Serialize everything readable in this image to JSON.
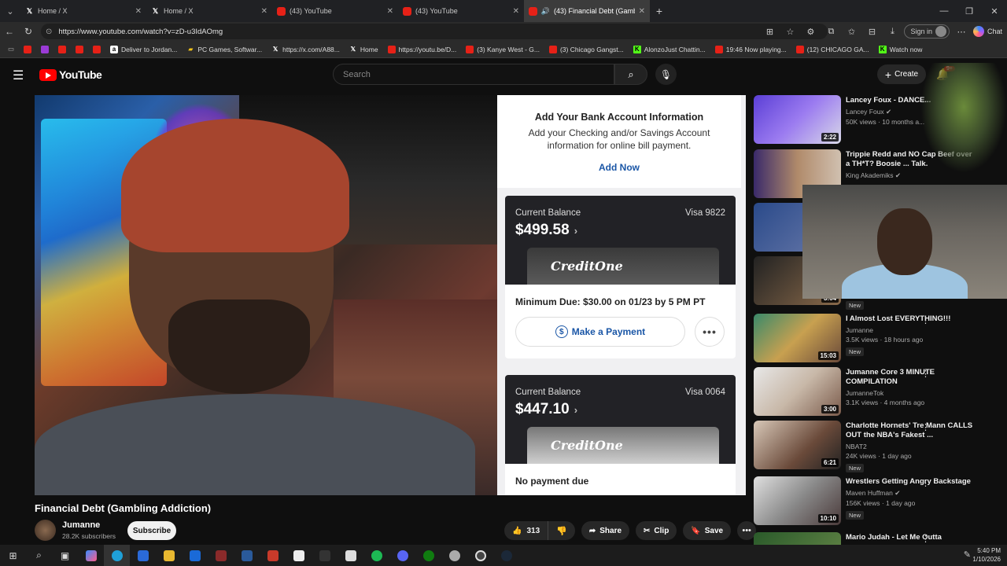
{
  "browser": {
    "tabs": [
      {
        "title": "Home / X",
        "icon": "x-icon"
      },
      {
        "title": "Home / X",
        "icon": "x-icon"
      },
      {
        "title": "(43) YouTube",
        "icon": "youtube-icon"
      },
      {
        "title": "(43) YouTube",
        "icon": "youtube-icon"
      },
      {
        "title": "(43) Financial Debt (Gambling",
        "icon": "youtube-icon",
        "active": true
      }
    ],
    "url": "https://www.youtube.com/watch?v=zD-u3IdAOmg",
    "signin_label": "Sign in",
    "chat_label": "Chat",
    "bookmarks": [
      {
        "label": "",
        "icon": "youtube-icon"
      },
      {
        "label": "",
        "icon": "purple-icon"
      },
      {
        "label": "",
        "icon": "youtube-icon"
      },
      {
        "label": "",
        "icon": "youtube-icon"
      },
      {
        "label": "",
        "icon": "youtube-icon"
      },
      {
        "label": "Deliver to Jordan...",
        "icon": "amazon-icon"
      },
      {
        "label": "PC Games, Softwar...",
        "icon": "pc-icon"
      },
      {
        "label": "https://x.com/A88...",
        "icon": "x-icon"
      },
      {
        "label": "Home",
        "icon": "x-icon"
      },
      {
        "label": "https://youtu.be/D...",
        "icon": "youtube-icon"
      },
      {
        "label": "(3) Kanye West - G...",
        "icon": "youtube-icon"
      },
      {
        "label": "(3) Chicago Gangst...",
        "icon": "youtube-icon"
      },
      {
        "label": "AlonzoJust Chattin...",
        "icon": "kick-icon"
      },
      {
        "label": "19:46 Now playing...",
        "icon": "youtube-icon"
      },
      {
        "label": "(12) CHICAGO GA...",
        "icon": "youtube-icon"
      },
      {
        "label": "Watch now",
        "icon": "kick-icon"
      }
    ]
  },
  "youtube": {
    "logo_text": "YouTube",
    "search_placeholder": "Search",
    "create_label": "Create",
    "notif_count": "9+"
  },
  "video_overlay": {
    "bank_title": "Add Your Bank Account Information",
    "bank_desc": "Add your Checking and/or Savings Account information for online bill payment.",
    "add_now": "Add Now",
    "cards": [
      {
        "label": "Current Balance",
        "visa": "Visa 9822",
        "balance": "$499.58",
        "brand": "CreditOne",
        "min_due": "Minimum Due: $30.00 on 01/23 by 5 PM PT",
        "pay_label": "Make a Payment"
      },
      {
        "label": "Current Balance",
        "visa": "Visa 0064",
        "balance": "$447.10",
        "brand": "CreditOne",
        "min_due": "No payment due"
      }
    ]
  },
  "video": {
    "title": "Financial Debt (Gambling Addiction)",
    "channel": "Jumanne",
    "subscribers": "28.2K subscribers",
    "subscribe_label": "Subscribe",
    "likes": "313",
    "share_label": "Share",
    "clip_label": "Clip",
    "save_label": "Save"
  },
  "recommendations": [
    {
      "title": "Lancey Foux - DANCE...",
      "channel": "Lancey Foux",
      "meta": "50K views · 10 months a...",
      "duration": "2:22",
      "new": false
    },
    {
      "title": "Trippie Redd and NO Cap Beef over a TH*T? Boosie ... Talk.",
      "channel": "King Akademiks",
      "meta": "",
      "duration": "",
      "new": false
    },
    {
      "title": "",
      "channel": "",
      "meta": "",
      "duration": "",
      "new": false
    },
    {
      "title": "",
      "channel": "",
      "meta": "",
      "duration": "3:04",
      "new": true
    },
    {
      "title": "I Almost Lost EVERYTHING!!!",
      "channel": "Jumanne",
      "meta": "3.5K views · 18 hours ago",
      "duration": "15:03",
      "new": true
    },
    {
      "title": "Jumanne Core 3 MINUTE COMPILATION",
      "channel": "JumanneTok",
      "meta": "3.1K views · 4 months ago",
      "duration": "3:00",
      "new": false
    },
    {
      "title": "Charlotte Hornets' Tre Mann CALLS OUT the NBA's Fakest ...",
      "channel": "NBAT2",
      "meta": "24K views · 1 day ago",
      "duration": "6:21",
      "new": true
    },
    {
      "title": "Wrestlers Getting Angry Backstage",
      "channel": "Maven Huffman",
      "meta": "156K views · 1 day ago",
      "duration": "10:10",
      "new": true
    },
    {
      "title": "Mario Judah - Let Me Outta",
      "channel": "",
      "meta": "",
      "duration": "",
      "new": false
    }
  ],
  "new_label": "New",
  "taskbar": {
    "time": "5:40 PM",
    "date": "1/10/2026"
  }
}
